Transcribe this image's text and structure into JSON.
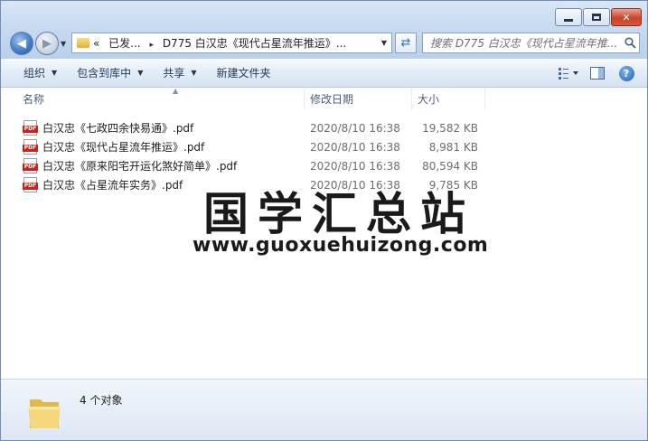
{
  "window": {
    "caption": {
      "minimize": "",
      "maximize": "",
      "close": "✕"
    }
  },
  "address": {
    "overflow": "«",
    "segment1": "已发...",
    "sep": "▸",
    "segment2": "D775 白汉忠《现代占星流年推运》..."
  },
  "search": {
    "placeholder": "搜索 D775 白汉忠《现代占星流年推..."
  },
  "toolbar": {
    "organize": "组织",
    "include_library": "包含到库中",
    "share": "共享",
    "new_folder": "新建文件夹"
  },
  "columns": {
    "name": "名称",
    "date": "修改日期",
    "size": "大小"
  },
  "files": [
    {
      "name": "白汉忠《七政四余快易通》.pdf",
      "date": "2020/8/10 16:38",
      "size": "19,582 KB"
    },
    {
      "name": "白汉忠《现代占星流年推运》.pdf",
      "date": "2020/8/10 16:38",
      "size": "8,981 KB"
    },
    {
      "name": "白汉忠《原来阳宅开运化煞好简单》.pdf",
      "date": "2020/8/10 16:38",
      "size": "80,594 KB"
    },
    {
      "name": "白汉忠《占星流年实务》.pdf",
      "date": "2020/8/10 16:38",
      "size": "9,785 KB"
    }
  ],
  "file_icon_label": "PDF",
  "watermark": {
    "title": "国学汇总站",
    "url": "www.guoxuehuizong.com"
  },
  "details": {
    "count": "4 个对象"
  }
}
